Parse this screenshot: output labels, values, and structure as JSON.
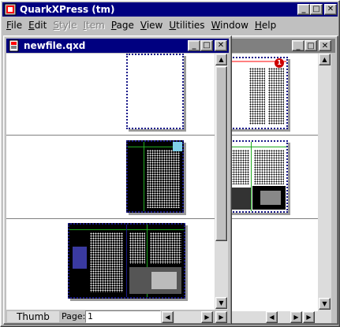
{
  "app": {
    "title": "QuarkXPress (tm)"
  },
  "menu": [
    {
      "label": "File",
      "ul": "F",
      "rest": "ile",
      "enabled": true
    },
    {
      "label": "Edit",
      "ul": "E",
      "rest": "dit",
      "enabled": true
    },
    {
      "label": "Style",
      "ul": "S",
      "rest": "tyle",
      "enabled": false
    },
    {
      "label": "Item",
      "ul": "I",
      "rest": "tem",
      "enabled": false
    },
    {
      "label": "Page",
      "ul": "P",
      "rest": "age",
      "enabled": true
    },
    {
      "label": "View",
      "ul": "V",
      "rest": "iew",
      "enabled": true
    },
    {
      "label": "Utilities",
      "ul": "U",
      "rest": "tilities",
      "enabled": true
    },
    {
      "label": "Window",
      "ul": "W",
      "rest": "indow",
      "enabled": true
    },
    {
      "label": "Help",
      "ul": "H",
      "rest": "elp",
      "enabled": true
    }
  ],
  "doc": {
    "title": "newfile.qxd",
    "view_label": "Thumb",
    "page_label": "Page:",
    "page_value": "1"
  },
  "back_doc": {
    "badge": "1"
  },
  "colors": {
    "titlebar": "#000080",
    "page_border": "#1a1a8a",
    "guide_green": "#1faa1f"
  }
}
